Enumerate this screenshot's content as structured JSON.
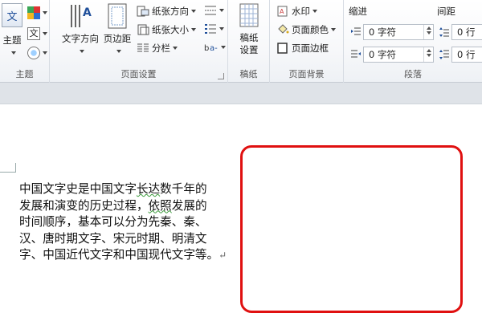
{
  "ribbon": {
    "theme_group": {
      "label": "主题",
      "theme_button": "主题",
      "theme_icon_text": "文",
      "font_icon_text": "文"
    },
    "page_setup_group": {
      "label": "页面设置",
      "text_direction": "文字方向",
      "margins": "页边距",
      "orientation": "纸张方向",
      "size": "纸张大小",
      "columns": "分栏"
    },
    "draft_group": {
      "label": "稿纸",
      "draft_settings_line1": "稿纸",
      "draft_settings_line2": "设置"
    },
    "page_background_group": {
      "label": "页面背景",
      "watermark": "水印",
      "page_color": "页面颜色",
      "page_border": "页面边框"
    },
    "paragraph_group": {
      "label": "段落",
      "indent_label": "缩进",
      "indent_left": "0 字符",
      "indent_right": "0 字符",
      "spacing_label": "间距",
      "spacing_before": "0 行",
      "spacing_after": "0 行"
    }
  },
  "document": {
    "line1_a": "中国文字史是中国文字",
    "line1_squiggle": "长达",
    "line1_b": "数千年的",
    "line2_a": "发展和演变的历史过程，",
    "line2_squiggle": "依照",
    "line2_b": "发展的",
    "line3": "时间顺序，基本可以分为先秦、秦、",
    "line4": "汉、唐时期文字、宋元时期、明清文",
    "line5": "字、中国近代文字和中国现代文字等。",
    "paragraph_mark": "↵"
  },
  "colors": {
    "highlight_box": "#e01010",
    "ribbon_bg": "#f7f8fa",
    "band_bg": "#dfe3e8"
  }
}
